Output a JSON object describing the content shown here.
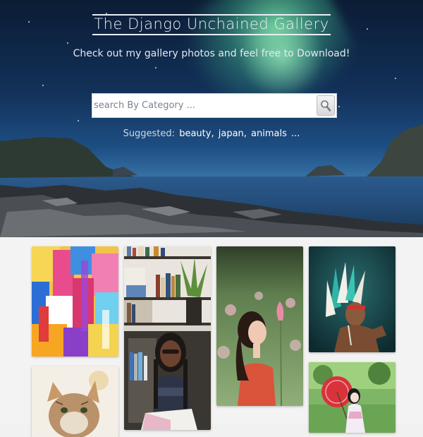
{
  "header": {
    "title": "The Django Unchained Gallery",
    "subtitle": "Check out my gallery photos and feel free to Download!"
  },
  "search": {
    "placeholder": "search By Category ...",
    "value": ""
  },
  "suggested": {
    "label": "Suggested:",
    "tags": [
      "beauty,",
      "japan,",
      "animals",
      "..."
    ]
  },
  "gallery": {
    "photos": [
      {
        "name": "abstract-painting",
        "icon": "abstract-art-image"
      },
      {
        "name": "woman-reading-bookshelf",
        "icon": "reading-woman-image"
      },
      {
        "name": "woman-lotus-field",
        "icon": "lotus-woman-image"
      },
      {
        "name": "native-headdress-man",
        "icon": "headdress-man-image"
      },
      {
        "name": "cat",
        "icon": "cat-image"
      },
      {
        "name": "girl-red-umbrella",
        "icon": "umbrella-girl-image"
      }
    ]
  },
  "colors": {
    "accent_text": "#ffffff",
    "hero_sky": "#123058",
    "aurora": "#7be6aa",
    "page_background": "#f3f3f3"
  }
}
